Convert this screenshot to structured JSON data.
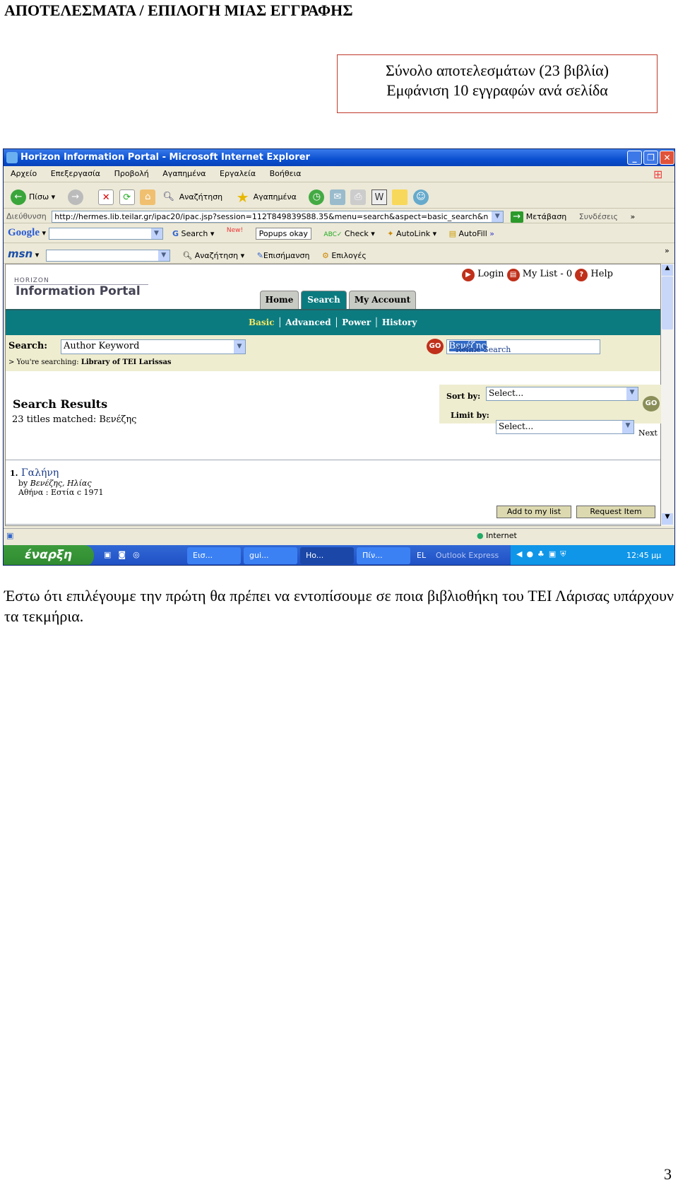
{
  "doc": {
    "title": "ΑΠΟΤΕΛΕΣΜΑΤΑ / ΕΠΙΛΟΓΗ ΜΙΑΣ ΕΓΓΡΑΦΗΣ",
    "box_line1": "Σύνολο αποτελεσμάτων (23 βιβλία)",
    "box_line2": "Εμφάνιση 10 εγγραφών ανά σελίδα",
    "paragraph": "Έστω ότι επιλέγουμε την πρώτη θα πρέπει να εντοπίσουμε σε ποια βιβλιοθήκη του ΤΕΙ Λάρισας υπάρχουν τα τεκμήρια.",
    "page_number": "3"
  },
  "browser": {
    "title": "Horizon Information Portal - Microsoft Internet Explorer",
    "menu": [
      "Αρχείο",
      "Επεξεργασία",
      "Προβολή",
      "Αγαπημένα",
      "Εργαλεία",
      "Βοήθεια"
    ],
    "toolbar": {
      "back": "Πίσω",
      "search": "Αναζήτηση",
      "favorites": "Αγαπημένα"
    },
    "address": {
      "label": "Διεύθυνση",
      "url": "http://hermes.lib.teilar.gr/ipac20/ipac.jsp?session=112T849839S88.35&menu=search&aspect=basic_search&n",
      "go": "Μετάβαση",
      "links": "Συνδέσεις"
    },
    "google": {
      "logo": "Google",
      "search": "Search",
      "new": "New!",
      "popups": "Popups okay",
      "check": "Check",
      "autolink": "AutoLink",
      "autofill": "AutoFill"
    },
    "msn": {
      "logo": "msn",
      "search": "Αναζήτηση",
      "highlight": "Επισήμανση",
      "options": "Επιλογές"
    },
    "status": "Internet"
  },
  "portal": {
    "logo_small": "HORIZON",
    "logo": "Information Portal",
    "top_links": {
      "login": "Login",
      "mylist": "My List - 0",
      "help": "Help"
    },
    "tabs": [
      "Home",
      "Search",
      "My Account"
    ],
    "subnav": [
      "Basic",
      "Advanced",
      "Power",
      "History"
    ],
    "search_label": "Search:",
    "search_type": "Author Keyword",
    "search_value": "Βενέζης",
    "go": "GO",
    "refine": "Refine Search",
    "searching_prefix": "> You're searching:",
    "searching_library": "Library of TEI Larissas",
    "results_heading": "Search Results",
    "results_count": "23 titles matched: Βενέζης",
    "sort_label": "Sort by:",
    "sort_value": "Select...",
    "limit_label": "Limit by:",
    "limit_value": "Select...",
    "next": "Next",
    "result": {
      "num": "1.",
      "title": "Γαλήνη",
      "by": "by",
      "author": "Βενέζης, Ηλίας",
      "pub": "Αθήνα : Εστία c 1971"
    },
    "add_list": "Add to my list",
    "request": "Request Item"
  },
  "taskbar": {
    "start": "έναρξη",
    "tasks": [
      "Εισ...",
      "gui...",
      "Ho...",
      "Πίν..."
    ],
    "lang": "EL",
    "outlook": "Outlook Express",
    "clock": "12:45 μμ"
  },
  "colors": {
    "teal": "#0b7b80",
    "band": "#efedd0",
    "accent": "#c0301a",
    "link": "#1a3c8a"
  }
}
